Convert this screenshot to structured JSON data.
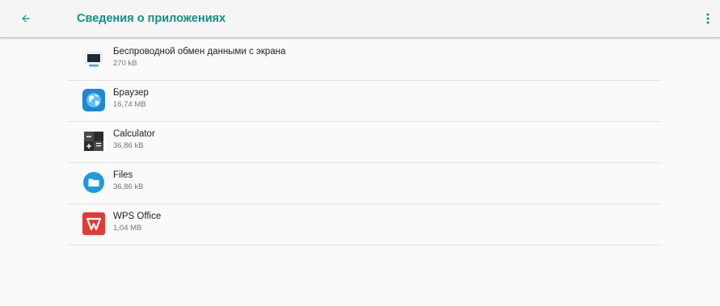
{
  "header": {
    "title": "Сведения о приложениях"
  },
  "apps": [
    {
      "name": "Беспроводной обмен данными с экрана",
      "size": "270 kB",
      "icon": "screen-mirror-icon"
    },
    {
      "name": "Браузер",
      "size": "16,74 MB",
      "icon": "globe-browser-icon"
    },
    {
      "name": "Calculator",
      "size": "36,86 kB",
      "icon": "calculator-icon"
    },
    {
      "name": "Files",
      "size": "36,86 kB",
      "icon": "folder-icon"
    },
    {
      "name": "WPS Office",
      "size": "1,04 MB",
      "icon": "wps-office-icon"
    }
  ],
  "colors": {
    "accent": "#0f8f87",
    "background": "#fafafa",
    "browser_icon": "#1e88d6",
    "files_icon": "#1d9ae0",
    "wps_icon": "#e53935"
  }
}
